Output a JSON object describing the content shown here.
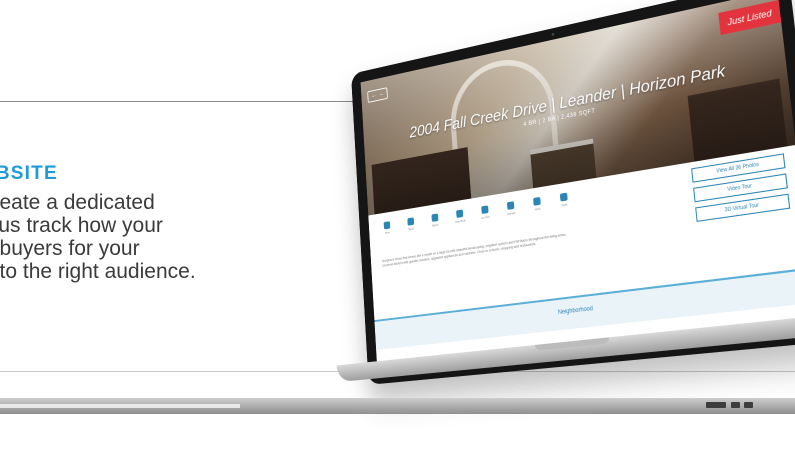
{
  "copy": {
    "heading": "EBSITE",
    "lines": [
      "create a dedicated",
      "s us track how your",
      "e buyers for your",
      "d to the right audience."
    ]
  },
  "site": {
    "badge": "Just Listed",
    "nav_icons": "← →",
    "title": "2004 Fall Creek Drive | Leander | Horizon Park",
    "subtitle": "4 BR | 2 BA | 2,438 SQFT",
    "amenities": [
      "Pets",
      "Beds",
      "Baths",
      "Year Built",
      "Lot Size",
      "Garage",
      "HOA",
      "Style"
    ],
    "actions": [
      "View All 36 Photos",
      "Video Tour",
      "3D Virtual Tour"
    ],
    "description": "Gorgeous home that shows like a model on a large lot with beautiful landscaping, irrigation system and HW floors throughout the living areas. Gourmet kitchen with granite counters, upgraded appliances and cabinets. Close to schools, shopping and restaurants.",
    "footer_link": "Neighborhood"
  },
  "colors": {
    "accent": "#1c9bd7",
    "badge": "#e3343e",
    "button": "#2b86b5"
  }
}
